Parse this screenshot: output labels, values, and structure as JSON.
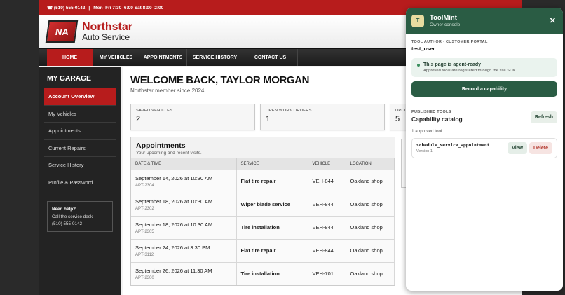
{
  "site": {
    "topbar": {
      "phone": "☎ (510) 555-0142",
      "divider": "|",
      "hours": "Mon–Fri 7:30–6:00   Sat 8:00–2:00"
    },
    "brand": {
      "logo_text": "NA",
      "line1": "Northstar",
      "line2": "Auto Service"
    },
    "nav": [
      "HOME",
      "MY VEHICLES",
      "APPOINTMENTS",
      "SERVICE HISTORY",
      "CONTACT US"
    ],
    "sidebar": {
      "title": "MY GARAGE",
      "items": [
        "Account Overview",
        "My Vehicles",
        "Appointments",
        "Current Repairs",
        "Service History",
        "Profile & Password"
      ],
      "help": {
        "title": "Need help?",
        "line1": "Call the service desk",
        "line2": "(510) 555-0142"
      }
    },
    "main": {
      "welcome": "WELCOME BACK, TAYLOR MORGAN",
      "since": "Northstar member since 2024",
      "stats": [
        {
          "label": "SAVED VEHICLES",
          "value": "2"
        },
        {
          "label": "OPEN WORK ORDERS",
          "value": "1"
        },
        {
          "label": "UPCO",
          "value": "5"
        }
      ],
      "appointments": {
        "title": "Appointments",
        "subtitle": "Your upcoming and recent visits.",
        "columns": [
          "DATE & TIME",
          "SERVICE",
          "VEHICLE",
          "LOCATION"
        ],
        "rows": [
          {
            "date": "September 14, 2026 at 10:30 AM",
            "id": "APT-2304",
            "service": "Flat tire repair",
            "vehicle": "VEH-844",
            "location": "Oakland shop"
          },
          {
            "date": "September 18, 2026 at 10:30 AM",
            "id": "APT-2302",
            "service": "Wiper blade service",
            "vehicle": "VEH-844",
            "location": "Oakland shop"
          },
          {
            "date": "September 18, 2026 at 10:30 AM",
            "id": "APT-2305",
            "service": "Tire installation",
            "vehicle": "VEH-844",
            "location": "Oakland shop"
          },
          {
            "date": "September 24, 2026 at 3:30 PM",
            "id": "APT-3112",
            "service": "Flat tire repair",
            "vehicle": "VEH-844",
            "location": "Oakland shop"
          },
          {
            "date": "September 26, 2026 at 11:30 AM",
            "id": "APT-2300",
            "service": "Tire installation",
            "vehicle": "VEH-701",
            "location": "Oakland shop"
          }
        ]
      }
    }
  },
  "panel": {
    "avatar": "T",
    "name": "ToolMint",
    "subtitle": "Owner console",
    "close": "✕",
    "author_label": "TOOL AUTHOR · CUSTOMER PORTAL",
    "author": "test_user",
    "ready_title": "This page is agent-ready",
    "ready_sub": "Approved tools are registered through the site SDK.",
    "record_label": "Record a capability",
    "published_label": "PUBLISHED TOOLS",
    "catalog_title": "Capability catalog",
    "refresh_label": "Refresh",
    "approved_count": "1 approved tool.",
    "tools": [
      {
        "name": "schedule_service_appointment",
        "version": "Version 1",
        "view": "View",
        "delete": "Delete"
      }
    ]
  },
  "colors": {
    "brand_red": "#b71c1c",
    "panel_green": "#2a5c44"
  }
}
